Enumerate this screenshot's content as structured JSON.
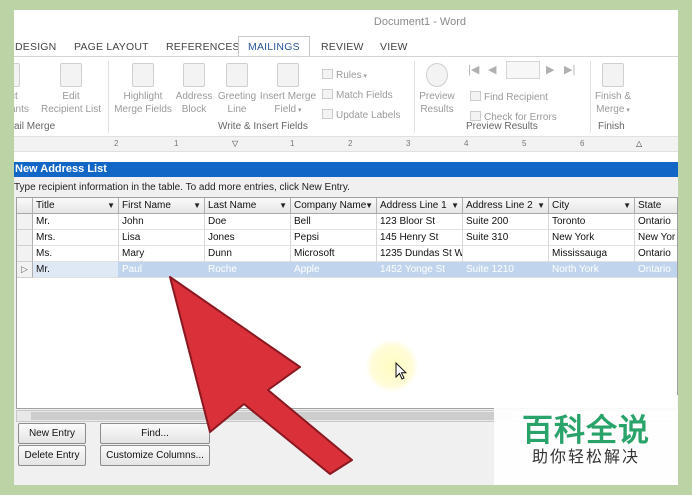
{
  "window": {
    "title": "Document1 - Word"
  },
  "tabs": [
    {
      "label": "DESIGN",
      "active": false
    },
    {
      "label": "PAGE LAYOUT",
      "active": false
    },
    {
      "label": "REFERENCES",
      "active": false
    },
    {
      "label": "MAILINGS",
      "active": true
    },
    {
      "label": "REVIEW",
      "active": false
    },
    {
      "label": "VIEW",
      "active": false
    }
  ],
  "ribbon": {
    "ct": "ct",
    "ants": "ants",
    "edit_recipient_line1": "Edit",
    "edit_recipient_line2": "Recipient List",
    "group_start": "ail Merge",
    "highlight_line1": "Highlight",
    "highlight_line2": "Merge Fields",
    "address_line1": "Address",
    "address_line2": "Block",
    "greeting_line1": "Greeting",
    "greeting_line2": "Line",
    "insert_line1": "Insert Merge",
    "insert_line2": "Field",
    "rules": "Rules",
    "match_fields": "Match Fields",
    "update_labels": "Update Labels",
    "group_write": "Write & Insert Fields",
    "preview_line1": "Preview",
    "preview_line2": "Results",
    "find_recipient": "Find Recipient",
    "check_errors": "Check for Errors",
    "group_preview": "Preview Results",
    "finish_line1": "Finish &",
    "finish_line2": "Merge",
    "group_finish": "Finish"
  },
  "ruler": {
    "numbers": [
      "2",
      "1",
      "1",
      "2",
      "3",
      "4",
      "5",
      "6"
    ]
  },
  "dialog": {
    "title": "New Address List",
    "instruction": "Type recipient information in the table.  To add more entries, click New Entry.",
    "columns": [
      "Title",
      "First Name",
      "Last Name",
      "Company Name",
      "Address Line 1",
      "Address Line 2",
      "City",
      "State"
    ],
    "rows": [
      [
        "Mr.",
        "John",
        "Doe",
        "Bell",
        "123 Bloor St",
        "Suite 200",
        "Toronto",
        "Ontario"
      ],
      [
        "Mrs.",
        "Lisa",
        "Jones",
        "Pepsi",
        "145 Henry St",
        "Suite 310",
        "New York",
        "New Yor"
      ],
      [
        "Ms.",
        "Mary",
        "Dunn",
        "Microsoft",
        "1235 Dundas St W",
        "",
        "Mississauga",
        "Ontario"
      ],
      [
        "Mr.",
        "Paul",
        "Roche",
        "Apple",
        "1452 Yonge St",
        "Suite 1210",
        "North York",
        "Ontario"
      ]
    ],
    "selected_row": 3,
    "buttons": {
      "new_entry": "New Entry",
      "find": "Find...",
      "delete_entry": "Delete Entry",
      "customize_columns": "Customize Columns..."
    }
  },
  "watermark": {
    "main": "百科全说",
    "sub": "助你轻松解决"
  },
  "icons": [
    "edit-recipient-icon",
    "highlight-icon",
    "address-block-icon",
    "greeting-line-icon",
    "insert-merge-field-icon",
    "rules-icon",
    "match-fields-icon",
    "update-labels-icon",
    "preview-results-icon",
    "first-record-icon",
    "previous-record-icon",
    "next-record-icon",
    "last-record-icon",
    "find-recipient-icon",
    "check-errors-icon",
    "finish-merge-icon",
    "dropdown-arrow-icon",
    "row-pointer-icon",
    "mouse-cursor-icon",
    "red-arrow-icon"
  ],
  "colors": {
    "dialog_title": "#1266c6",
    "selected_row": "#c0d5ed",
    "arrow": "#d9303a",
    "watermark": "#2aa36b",
    "background": "#bcd3a6"
  }
}
